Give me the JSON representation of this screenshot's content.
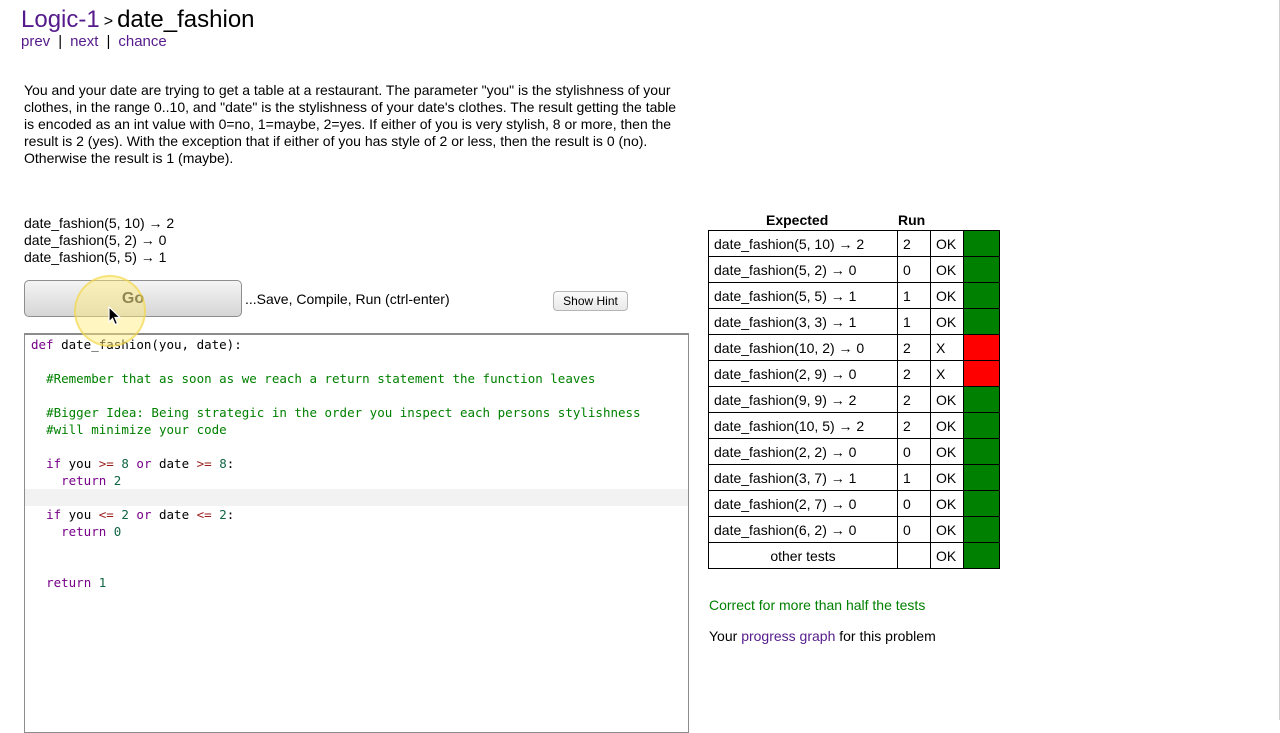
{
  "header": {
    "breadcrumb_parent": "Logic-1",
    "breadcrumb_sep": ">",
    "problem_name": "date_fashion"
  },
  "nav": {
    "prev": "prev",
    "next": "next",
    "chance": "chance",
    "sep": "|"
  },
  "description": "You and your date are trying to get a table at a restaurant. The parameter \"you\" is the stylishness of your clothes, in the range 0..10, and \"date\" is the stylishness of your date's clothes. The result getting the table is encoded as an int value with 0=no, 1=maybe, 2=yes. If either of you is very stylish, 8 or more, then the result is 2 (yes). With the exception that if either of you has style of 2 or less, then the result is 0 (no). Otherwise the result is 1 (maybe).",
  "examples": [
    "date_fashion(5, 10) → 2",
    "date_fashion(5, 2) → 0",
    "date_fashion(5, 5) → 1"
  ],
  "toolbar": {
    "go_label": "Go",
    "save_text": "...Save, Compile, Run (ctrl-enter)",
    "hint_label": "Show Hint"
  },
  "code": {
    "l1_kw": "def",
    "l1_rest": " date_fashion(you, date):",
    "l3": "#Remember that as soon as we reach a return statement the function leaves",
    "l5": "#Bigger Idea: Being strategic in the order you inspect each persons stylishness",
    "l6": "#will minimize your code",
    "l8_if": "if",
    "l8_a": " you ",
    "l8_op1": ">=",
    "l8_n1": "8",
    "l8_or": "or",
    "l8_b": " date ",
    "l8_op2": ">=",
    "l8_n2": "8",
    "l8_end": ":",
    "l9_ret": "return",
    "l9_n": "2",
    "l11_if": "if",
    "l11_a": " you ",
    "l11_op1": "<=",
    "l11_n1": "2",
    "l11_or": "or",
    "l11_b": " date ",
    "l11_op2": "<=",
    "l11_n2": "2",
    "l11_end": ":",
    "l12_ret": "return",
    "l12_n": "0",
    "l15_ret": "return",
    "l15_n": "1"
  },
  "results": {
    "col_expected": "Expected",
    "col_run": "Run",
    "rows": [
      {
        "expr": "date_fashion(5, 10) → 2",
        "run": "2",
        "status": "OK",
        "color": "#008000"
      },
      {
        "expr": "date_fashion(5, 2) → 0",
        "run": "0",
        "status": "OK",
        "color": "#008000"
      },
      {
        "expr": "date_fashion(5, 5) → 1",
        "run": "1",
        "status": "OK",
        "color": "#008000"
      },
      {
        "expr": "date_fashion(3, 3) → 1",
        "run": "1",
        "status": "OK",
        "color": "#008000"
      },
      {
        "expr": "date_fashion(10, 2) → 0",
        "run": "2",
        "status": "X",
        "color": "#ff0000"
      },
      {
        "expr": "date_fashion(2, 9) → 0",
        "run": "2",
        "status": "X",
        "color": "#ff0000"
      },
      {
        "expr": "date_fashion(9, 9) → 2",
        "run": "2",
        "status": "OK",
        "color": "#008000"
      },
      {
        "expr": "date_fashion(10, 5) → 2",
        "run": "2",
        "status": "OK",
        "color": "#008000"
      },
      {
        "expr": "date_fashion(2, 2) → 0",
        "run": "0",
        "status": "OK",
        "color": "#008000"
      },
      {
        "expr": "date_fashion(3, 7) → 1",
        "run": "1",
        "status": "OK",
        "color": "#008000"
      },
      {
        "expr": "date_fashion(2, 7) → 0",
        "run": "0",
        "status": "OK",
        "color": "#008000"
      },
      {
        "expr": "date_fashion(6, 2) → 0",
        "run": "0",
        "status": "OK",
        "color": "#008000"
      },
      {
        "expr": "other tests",
        "run": "",
        "status": "OK",
        "color": "#008000"
      }
    ]
  },
  "summary": {
    "correct_text": "Correct for more than half the tests",
    "progress_prefix": "Your ",
    "progress_link": "progress graph",
    "progress_suffix": " for this problem"
  }
}
